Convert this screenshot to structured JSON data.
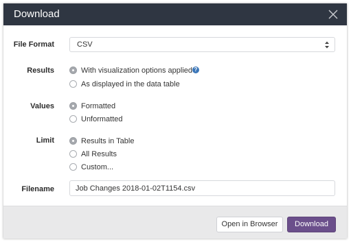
{
  "dialog": {
    "title": "Download",
    "close_icon": "close-icon"
  },
  "form": {
    "file_format": {
      "label": "File Format",
      "selected": "CSV",
      "options": [
        "CSV"
      ]
    },
    "results": {
      "label": "Results",
      "options": [
        {
          "label": "With visualization options applied",
          "checked": true,
          "help_icon": "question-circle-icon"
        },
        {
          "label": "As displayed in the data table",
          "checked": false
        }
      ]
    },
    "values": {
      "label": "Values",
      "options": [
        {
          "label": "Formatted",
          "checked": true
        },
        {
          "label": "Unformatted",
          "checked": false
        }
      ]
    },
    "limit": {
      "label": "Limit",
      "options": [
        {
          "label": "Results in Table",
          "checked": true
        },
        {
          "label": "All Results",
          "checked": false
        },
        {
          "label": "Custom...",
          "checked": false
        }
      ]
    },
    "filename": {
      "label": "Filename",
      "value": "Job Changes 2018-01-02T1154.csv"
    }
  },
  "footer": {
    "open_in_browser_label": "Open in Browser",
    "download_label": "Download"
  },
  "colors": {
    "header_bg": "#2f3642",
    "primary_button": "#6b4f8b",
    "help_icon": "#3b76b8",
    "footer_bg": "#e9e9ea"
  }
}
